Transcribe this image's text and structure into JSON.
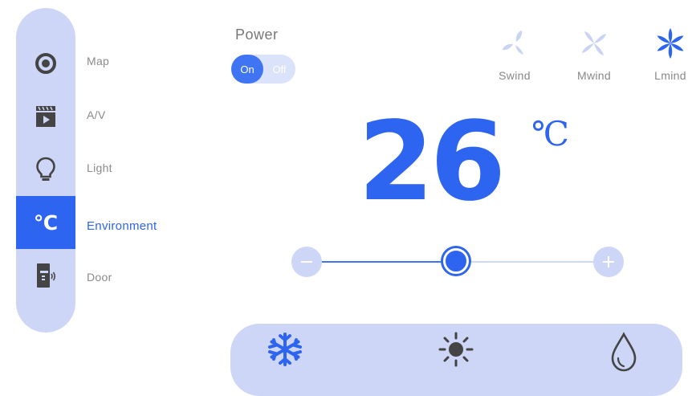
{
  "sidebar": {
    "items": [
      {
        "label": "Map",
        "icon": "target-icon",
        "active": false
      },
      {
        "label": "A/V",
        "icon": "clapperboard-play-icon",
        "active": false
      },
      {
        "label": "Light",
        "icon": "lightbulb-icon",
        "active": false
      },
      {
        "label": "Environment",
        "icon": "celsius-icon",
        "active": true,
        "glyph": "℃"
      },
      {
        "label": "Door",
        "icon": "door-lock-icon",
        "active": false
      }
    ]
  },
  "power": {
    "title": "Power",
    "on_label": "On",
    "off_label": "Off",
    "state": "On"
  },
  "wind_modes": [
    {
      "label": "Swind",
      "icon": "fan-2-blade-icon",
      "active": false
    },
    {
      "label": "Mwind",
      "icon": "fan-4-blade-icon",
      "active": false
    },
    {
      "label": "Lmind",
      "icon": "fan-6-blade-icon",
      "active": true
    }
  ],
  "temperature": {
    "value": "26",
    "unit": "℃"
  },
  "slider": {
    "level": 0.5,
    "minus_icon": "minus-icon",
    "plus_icon": "plus-icon"
  },
  "modes": [
    {
      "name": "cool",
      "icon": "snowflake-icon",
      "active": true
    },
    {
      "name": "heat",
      "icon": "sun-icon",
      "active": false
    },
    {
      "name": "dry",
      "icon": "water-drop-icon",
      "active": false
    }
  ],
  "colors": {
    "accent": "#2d64f0",
    "soft": "#cdd6f6",
    "inactive_icon": "#444444"
  }
}
